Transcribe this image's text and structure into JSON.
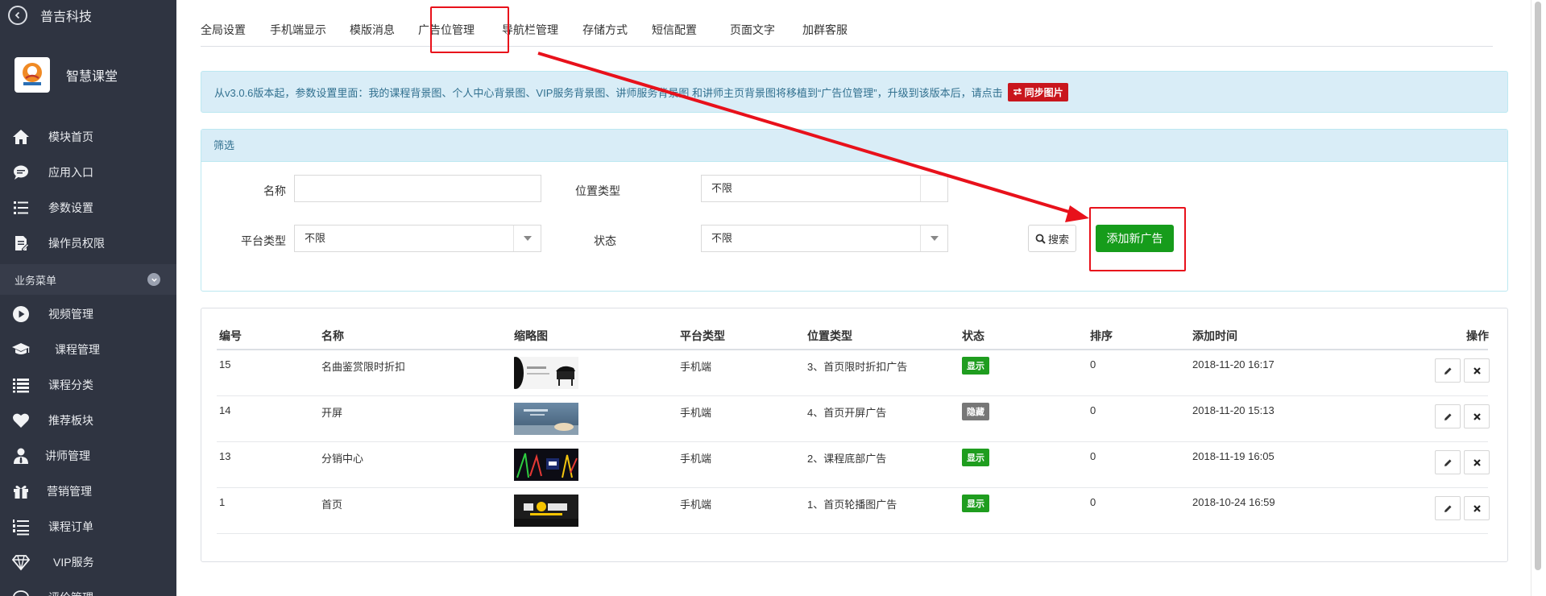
{
  "sidebar": {
    "brand": "普吉科技",
    "app_name": "智慧课堂",
    "menu_top": [
      {
        "label": "模块首页",
        "icon": "home-icon"
      },
      {
        "label": "应用入口",
        "icon": "chat-bubble-icon"
      },
      {
        "label": "参数设置",
        "icon": "list-settings-icon"
      },
      {
        "label": "操作员权限",
        "icon": "document-edit-icon"
      }
    ],
    "section_label": "业务菜单",
    "menu_biz": [
      {
        "label": "视频管理",
        "icon": "play-circle-icon"
      },
      {
        "label": "课程管理",
        "icon": "graduation-cap-icon"
      },
      {
        "label": "课程分类",
        "icon": "list-icon"
      },
      {
        "label": "推荐板块",
        "icon": "heart-icon"
      },
      {
        "label": "讲师管理",
        "icon": "user-tie-icon"
      },
      {
        "label": "营销管理",
        "icon": "gift-icon"
      },
      {
        "label": "课程订单",
        "icon": "numbered-list-icon"
      },
      {
        "label": "VIP服务",
        "icon": "diamond-icon"
      },
      {
        "label": "评价管理",
        "icon": "comment-icon"
      }
    ]
  },
  "tabs": [
    "全局设置",
    "手机端显示",
    "模版消息",
    "广告位管理",
    "导航栏管理",
    "存储方式",
    "短信配置",
    "页面文字",
    "加群客服"
  ],
  "active_tab": "广告位管理",
  "notice": {
    "text": "从v3.0.6版本起，参数设置里面：我的课程背景图、个人中心背景图、VIP服务背景图、讲师服务背景图 和讲师主页背景图将移植到“广告位管理”，升级到该版本后，请点击",
    "button_label": "同步图片"
  },
  "filter": {
    "title": "筛选",
    "name_label": "名称",
    "name_value": "",
    "position_label": "位置类型",
    "position_value": "不限",
    "platform_label": "平台类型",
    "platform_value": "不限",
    "status_label": "状态",
    "status_value": "不限",
    "search_label": "搜索",
    "add_label": "添加新广告"
  },
  "table": {
    "columns": [
      "编号",
      "名称",
      "缩略图",
      "平台类型",
      "位置类型",
      "状态",
      "排序",
      "添加时间",
      "操作"
    ],
    "rows": [
      {
        "id": "15",
        "name": "名曲鉴赏限时折扣",
        "thumb": "piano-music",
        "platform": "手机端",
        "position": "3、首页限时折扣广告",
        "status": "显示",
        "sort": "0",
        "time": "2018-11-20 16:17"
      },
      {
        "id": "14",
        "name": "开屏",
        "thumb": "desk-photo",
        "platform": "手机端",
        "position": "4、首页开屏广告",
        "status": "隐藏",
        "sort": "0",
        "time": "2018-11-20 15:13"
      },
      {
        "id": "13",
        "name": "分销中心",
        "thumb": "neon-dark",
        "platform": "手机端",
        "position": "2、课程底部广告",
        "status": "显示",
        "sort": "0",
        "time": "2018-11-19 16:05"
      },
      {
        "id": "1",
        "name": "首页",
        "thumb": "study-banner",
        "platform": "手机端",
        "position": "1、首页轮播图广告",
        "status": "显示",
        "sort": "0",
        "time": "2018-10-24 16:59"
      }
    ]
  },
  "colors": {
    "sidebar_bg": "#2f3441",
    "highlight_red": "#e8111b",
    "add_green": "#169c1b",
    "badge_show": "#1f9d1f",
    "badge_hide": "#777777",
    "sync_red": "#c9161d"
  }
}
